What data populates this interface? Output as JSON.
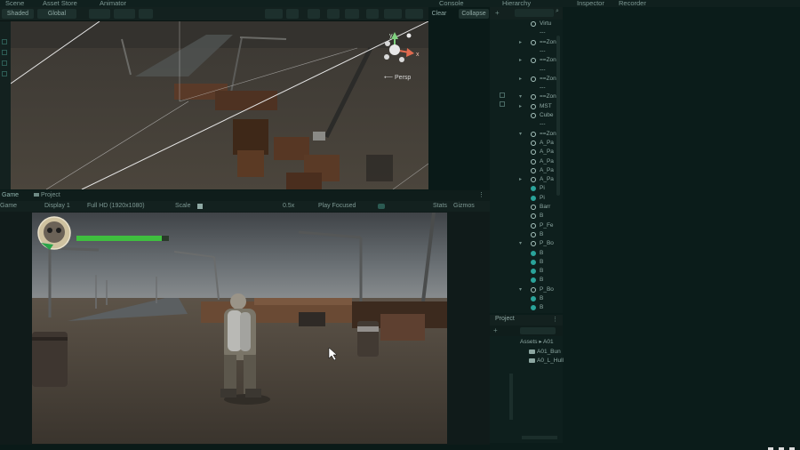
{
  "tabs": {
    "scene": "Scene",
    "asset_store": "Asset Store",
    "animator": "Animator",
    "console": "Console",
    "hierarchy": "Hierarchy",
    "inspector": "Inspector",
    "recorder": "Recorder"
  },
  "scene_toolbar": {
    "shaded": "Shaded",
    "global": "Global",
    "clear": "Clear",
    "collapse": "Collapse",
    "persp_label": "Persp",
    "gizmo_y": "y",
    "gizmo_x": "x"
  },
  "game_tabs": {
    "game": "Game",
    "project": "Project"
  },
  "game_toolbar": {
    "game_mode": "Game",
    "display": "Display 1",
    "resolution": "Full HD (1920x1080)",
    "scale_label": "Scale",
    "scale_value": "0.5x",
    "play_focused": "Play Focused",
    "stats": "Stats",
    "gizmos": "Gizmos"
  },
  "hud": {
    "health_fraction": 0.92,
    "health_color": "#3fbf3f"
  },
  "hierarchy": {
    "rows": [
      {
        "label": "Virtu",
        "icon": "object",
        "arrow": ""
      },
      {
        "label": "---",
        "icon": "",
        "arrow": ""
      },
      {
        "label": "==Zon",
        "icon": "object",
        "arrow": "▸"
      },
      {
        "label": "---",
        "icon": "",
        "arrow": ""
      },
      {
        "label": "==Zon",
        "icon": "object",
        "arrow": "▸"
      },
      {
        "label": "---",
        "icon": "",
        "arrow": ""
      },
      {
        "label": "==Zon",
        "icon": "object",
        "arrow": "▸"
      },
      {
        "label": "---",
        "icon": "",
        "arrow": ""
      },
      {
        "label": "==Zon",
        "icon": "object",
        "arrow": "▾"
      },
      {
        "label": "MST",
        "icon": "object",
        "arrow": "▸"
      },
      {
        "label": "Cube",
        "icon": "object",
        "arrow": ""
      },
      {
        "label": "---",
        "icon": "",
        "arrow": ""
      },
      {
        "label": "==Zon",
        "icon": "object",
        "arrow": "▾"
      },
      {
        "label": "A_Pa",
        "icon": "object",
        "arrow": ""
      },
      {
        "label": "A_Pa",
        "icon": "object",
        "arrow": ""
      },
      {
        "label": "A_Pa",
        "icon": "object",
        "arrow": ""
      },
      {
        "label": "A_Pa",
        "icon": "object",
        "arrow": ""
      },
      {
        "label": "A_Pa",
        "icon": "object",
        "arrow": "▸"
      },
      {
        "label": "Pi",
        "icon": "prefab",
        "arrow": ""
      },
      {
        "label": "Pi",
        "icon": "prefab",
        "arrow": ""
      },
      {
        "label": "Barr",
        "icon": "object",
        "arrow": ""
      },
      {
        "label": "B",
        "icon": "object",
        "arrow": ""
      },
      {
        "label": "P_Fe",
        "icon": "object",
        "arrow": ""
      },
      {
        "label": "B",
        "icon": "object",
        "arrow": ""
      },
      {
        "label": "P_Bo",
        "icon": "object",
        "arrow": "▾"
      },
      {
        "label": "B",
        "icon": "prefab",
        "arrow": ""
      },
      {
        "label": "B",
        "icon": "prefab",
        "arrow": ""
      },
      {
        "label": "B",
        "icon": "prefab",
        "arrow": ""
      },
      {
        "label": "B",
        "icon": "prefab",
        "arrow": ""
      },
      {
        "label": "P_Bo",
        "icon": "object",
        "arrow": "▾"
      },
      {
        "label": "B",
        "icon": "prefab",
        "arrow": ""
      },
      {
        "label": "B",
        "icon": "prefab",
        "arrow": ""
      }
    ]
  },
  "project": {
    "title": "Project",
    "breadcrumb_root": "Assets",
    "breadcrumb_child": "A01",
    "folders": [
      "A01_Bun",
      "A0_L_Hull"
    ]
  }
}
